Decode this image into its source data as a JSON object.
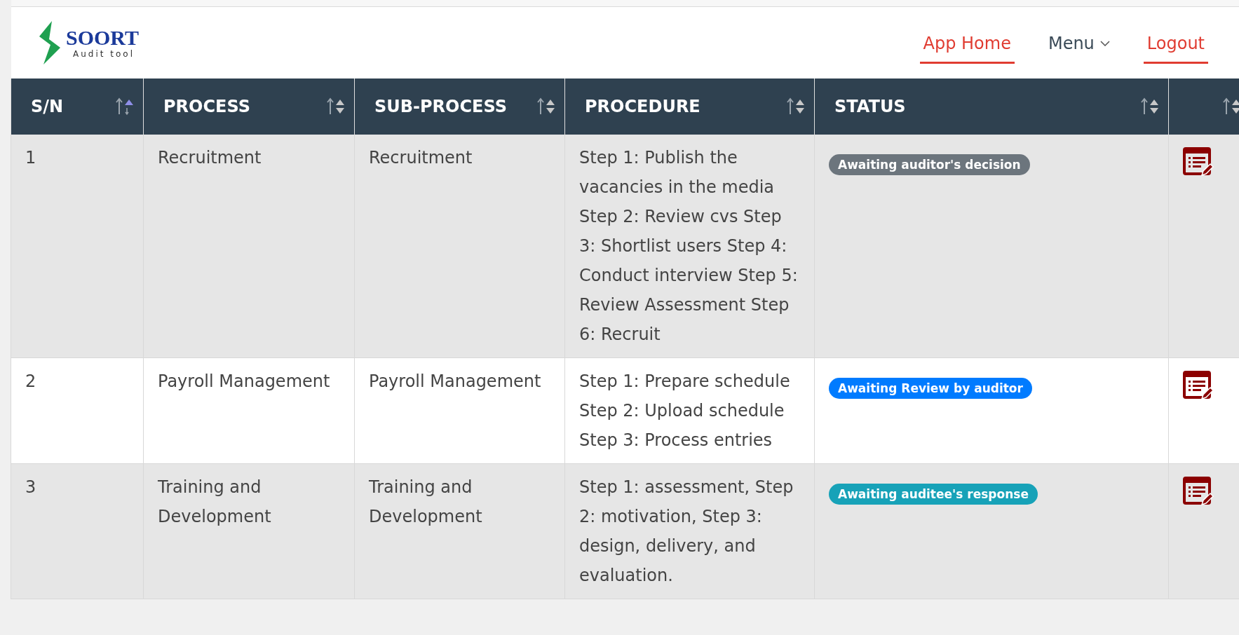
{
  "logo": {
    "name": "SOORT",
    "tagline": "Audit tool"
  },
  "nav": [
    {
      "kind": "link",
      "label": "App Home"
    },
    {
      "kind": "dropdown",
      "label": "Menu"
    },
    {
      "kind": "link",
      "label": "Logout"
    }
  ],
  "table": {
    "columns": [
      {
        "label": "S/N",
        "sorted": true
      },
      {
        "label": "PROCESS",
        "sorted": false
      },
      {
        "label": "SUB-PROCESS",
        "sorted": false
      },
      {
        "label": "PROCEDURE",
        "sorted": false
      },
      {
        "label": "STATUS",
        "sorted": false
      },
      {
        "sorted": false
      }
    ],
    "rows": [
      {
        "sn": "1",
        "process": "Recruitment",
        "sub_process": "Recruitment",
        "procedure": "Step 1: Publish the vacancies in the media Step 2: Review cvs Step 3: Shortlist users Step 4: Conduct interview Step 5: Review Assessment Step 6: Recruit",
        "status": {
          "label": "Awaiting auditor's decision",
          "color": "#6c757d"
        }
      },
      {
        "sn": "2",
        "process": "Payroll Management",
        "sub_process": "Payroll Management",
        "procedure": "Step 1: Prepare schedule Step 2: Upload schedule Step 3: Process entries",
        "status": {
          "label": "Awaiting Review by auditor",
          "color": "#007bff"
        }
      },
      {
        "sn": "3",
        "process": "Training and Development",
        "sub_process": "Training and Development",
        "procedure": "Step 1: assessment, Step 2: motivation, Step 3: design, delivery, and evaluation.",
        "status": {
          "label": "Awaiting auditee's response",
          "color": "#17a2b8"
        }
      }
    ]
  }
}
